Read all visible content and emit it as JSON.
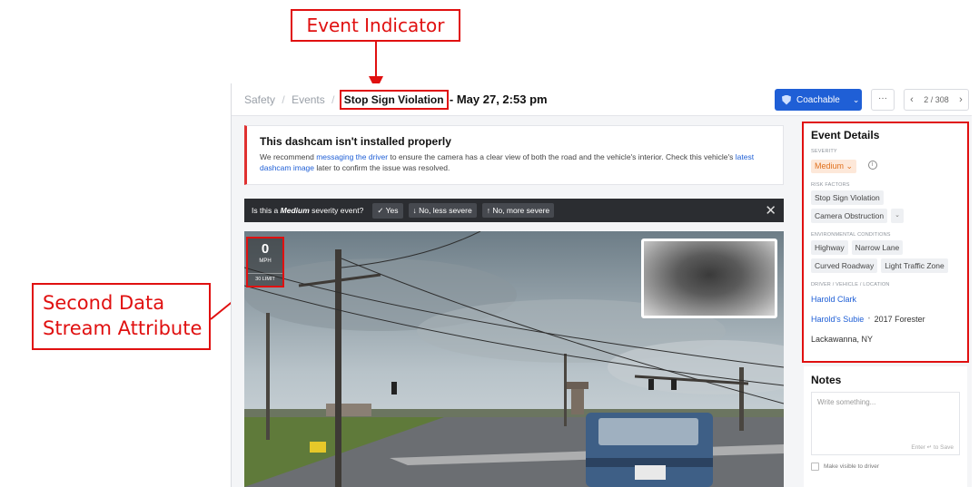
{
  "annotations": {
    "event_indicator": "Event Indicator",
    "second_stream_line1": "Second Data",
    "second_stream_line2": "Stream Attribute"
  },
  "topbar": {
    "breadcrumb": [
      "Safety",
      "Events"
    ],
    "event_type": "Stop Sign Violation",
    "event_date": "- May 27, 2:53 pm",
    "coachable_label": "Coachable",
    "more_label": "···",
    "pager": "2 / 308",
    "prev_icon": "‹",
    "next_icon": "›"
  },
  "alert": {
    "title": "This dashcam isn't installed properly",
    "body_1": "We recommend ",
    "link_1": "messaging the driver",
    "body_2": " to ensure the camera has a clear view of both the road and the vehicle's interior. Check this vehicle's ",
    "link_2": "latest dashcam image",
    "body_3": " later to confirm the issue was resolved."
  },
  "severity_prompt": {
    "q_prefix": "Is this a ",
    "q_em": "Medium",
    "q_suffix": " severity event?",
    "yes": "✓ Yes",
    "less": "↓ No, less severe",
    "more": "↑ No, more severe",
    "close": "✕"
  },
  "video": {
    "speed_value": "0",
    "speed_unit": "MPH",
    "speed_limit": "30 LIMIT"
  },
  "details": {
    "title": "Event Details",
    "severity_label": "SEVERITY",
    "severity_value": "Medium ⌄",
    "info_icon": "i",
    "risk_label": "RISK FACTORS",
    "risk_factors": [
      "Stop Sign Violation",
      "Camera Obstruction"
    ],
    "risk_more": "⌄",
    "env_label": "ENVIRONMENTAL CONDITIONS",
    "env_conditions": [
      "Highway",
      "Narrow Lane",
      "Curved Roadway",
      "Light Traffic Zone"
    ],
    "dvl_label": "DRIVER / VEHICLE / LOCATION",
    "driver": "Harold Clark",
    "vehicle": "Harold's Subie",
    "vehicle_model": "2017 Forester",
    "location": "Lackawanna, NY"
  },
  "notes": {
    "title": "Notes",
    "placeholder": "Write something...",
    "hint": "Enter ↵ to Save",
    "visible_label": "Make visible to driver"
  },
  "colors": {
    "annotation": "#e01010",
    "primary": "#1f5fd6",
    "severity_medium": "#e0711e",
    "alert_accent": "#e03131"
  }
}
